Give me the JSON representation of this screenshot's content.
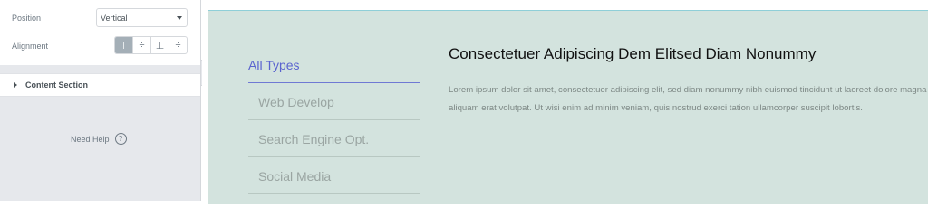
{
  "editor": {
    "position_label": "Position",
    "position_value": "Vertical",
    "alignment_label": "Alignment",
    "alignment_options": [
      {
        "name": "align-top-icon",
        "glyph": "⊤",
        "active": true
      },
      {
        "name": "align-middle-icon",
        "glyph": "÷",
        "active": false
      },
      {
        "name": "align-bottom-icon",
        "glyph": "⊥",
        "active": false
      },
      {
        "name": "align-stretch-icon",
        "glyph": "÷",
        "active": false
      }
    ],
    "section_title": "Content Section",
    "help_label": "Need Help",
    "help_icon": "?",
    "collapse_glyph": "‹"
  },
  "preview": {
    "tabs": [
      {
        "label": "All Types",
        "active": true
      },
      {
        "label": "Web Develop",
        "active": false
      },
      {
        "label": "Search Engine Opt.",
        "active": false
      },
      {
        "label": "Social Media",
        "active": false
      }
    ],
    "title": "Consectetuer Adipiscing Dem Elitsed Diam Nonummy",
    "body": "Lorem ipsum dolor sit amet, consectetuer adipiscing elit, sed diam nonummy nibh euismod tincidunt ut laoreet dolore magna aliquam erat volutpat. Ut wisi enim ad minim veniam, quis nostrud exerci tation ullamcorper suscipit lobortis.",
    "accent_color": "#5a63cf",
    "background_color": "#d3e3de"
  }
}
